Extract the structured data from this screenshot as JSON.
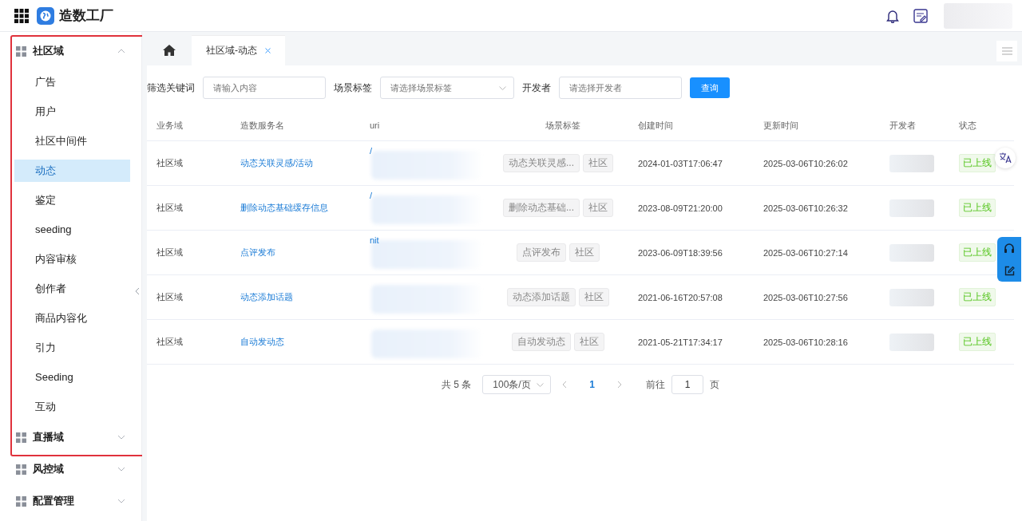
{
  "app": {
    "title": "造数工厂"
  },
  "sidebar": {
    "groups": [
      {
        "label": "社区域",
        "expanded": true,
        "children": [
          {
            "label": "广告",
            "selected": false
          },
          {
            "label": "用户",
            "selected": false
          },
          {
            "label": "社区中间件",
            "selected": false
          },
          {
            "label": "动态",
            "selected": true
          },
          {
            "label": "鉴定",
            "selected": false
          },
          {
            "label": "seeding",
            "selected": false
          },
          {
            "label": "内容审核",
            "selected": false
          },
          {
            "label": "创作者",
            "selected": false
          },
          {
            "label": "商品内容化",
            "selected": false
          },
          {
            "label": "引力",
            "selected": false
          },
          {
            "label": "Seeding",
            "selected": false
          },
          {
            "label": "互动",
            "selected": false
          }
        ]
      },
      {
        "label": "直播域",
        "expanded": false
      },
      {
        "label": "风控域",
        "expanded": false
      },
      {
        "label": "配置管理",
        "expanded": false
      }
    ]
  },
  "tabs": [
    {
      "label": "社区域-动态",
      "selected": true
    }
  ],
  "filters": [
    {
      "label": "筛选关键词",
      "kind": "input",
      "placeholder": "请输入内容"
    },
    {
      "label": "场景标签",
      "kind": "select",
      "placeholder": "请选择场景标签"
    },
    {
      "label": "开发者",
      "kind": "input",
      "placeholder": "请选择开发者"
    }
  ],
  "query_button": "查询",
  "table": {
    "columns": [
      "业务域",
      "造数服务名",
      "uri",
      "场景标签",
      "创建时间",
      "更新时间",
      "开发者",
      "状态"
    ],
    "rows": [
      {
        "domain": "社区域",
        "name": "动态关联灵感/活动",
        "uri": "/",
        "tags": [
          "动态关联灵感...",
          "社区"
        ],
        "created": "2024-01-03T17:06:47",
        "updated": "2025-03-06T10:26:02",
        "status": "已上线"
      },
      {
        "domain": "社区域",
        "name": "删除动态基础缓存信息",
        "uri": "/",
        "tags": [
          "删除动态基础...",
          "社区"
        ],
        "created": "2023-08-09T21:20:00",
        "updated": "2025-03-06T10:26:32",
        "status": "已上线"
      },
      {
        "domain": "社区域",
        "name": "点评发布",
        "uri": "nit",
        "tags": [
          "点评发布",
          "社区"
        ],
        "created": "2023-06-09T18:39:56",
        "updated": "2025-03-06T10:27:14",
        "status": "已上线"
      },
      {
        "domain": "社区域",
        "name": "动态添加话题",
        "tags": [
          "动态添加话题",
          "社区"
        ],
        "created": "2021-06-16T20:57:08",
        "updated": "2025-03-06T10:27:56",
        "status": "已上线"
      },
      {
        "domain": "社区域",
        "name": "自动发动态",
        "tags": [
          "自动发动态",
          "社区"
        ],
        "created": "2021-05-21T17:34:17",
        "updated": "2025-03-06T10:28:16",
        "status": "已上线"
      }
    ]
  },
  "pagination": {
    "total": "共 5 条",
    "page_size": "100条/页",
    "pages": [
      {
        "label": "1",
        "selected": true
      }
    ],
    "goto_label": "前往",
    "goto_value": "1",
    "goto_suffix": "页"
  }
}
